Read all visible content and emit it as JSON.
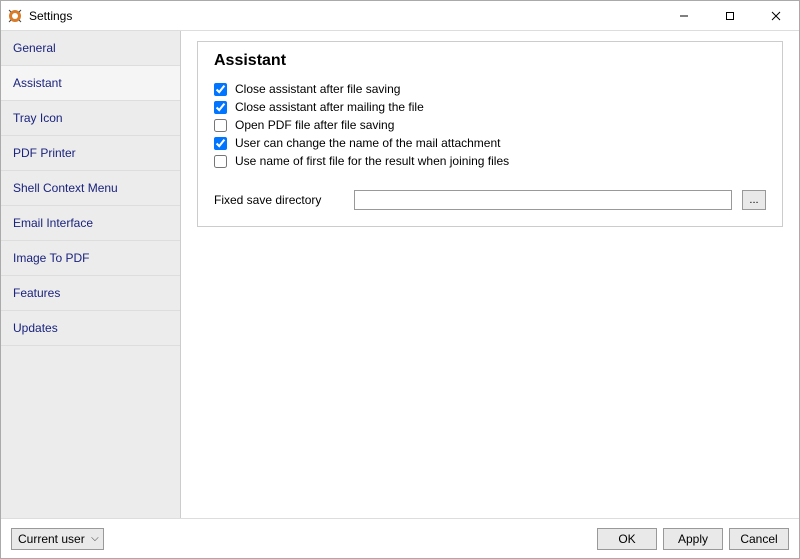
{
  "window": {
    "title": "Settings"
  },
  "sidebar": {
    "items": [
      {
        "label": "General"
      },
      {
        "label": "Assistant"
      },
      {
        "label": "Tray Icon"
      },
      {
        "label": "PDF Printer"
      },
      {
        "label": "Shell Context Menu"
      },
      {
        "label": "Email Interface"
      },
      {
        "label": "Image To PDF"
      },
      {
        "label": "Features"
      },
      {
        "label": "Updates"
      }
    ],
    "selected": "Assistant"
  },
  "main": {
    "group_title": "Assistant",
    "checkboxes": [
      {
        "label": "Close assistant after file saving",
        "checked": true
      },
      {
        "label": "Close assistant after mailing the file",
        "checked": true
      },
      {
        "label": "Open PDF file after file saving",
        "checked": false
      },
      {
        "label": "User can change the name of the mail attachment",
        "checked": true
      },
      {
        "label": "Use name of first file for the result when joining files",
        "checked": false
      }
    ],
    "fixed_dir": {
      "label": "Fixed save directory",
      "value": "",
      "browse_label": "..."
    }
  },
  "footer": {
    "user_select": "Current user",
    "ok": "OK",
    "apply": "Apply",
    "cancel": "Cancel"
  }
}
